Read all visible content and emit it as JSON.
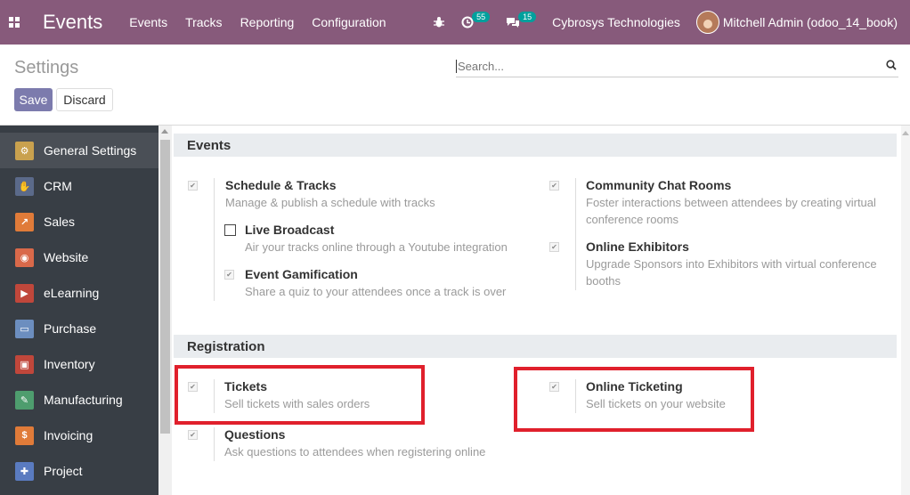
{
  "navbar": {
    "brand": "Events",
    "menu": [
      "Events",
      "Tracks",
      "Reporting",
      "Configuration"
    ],
    "activity_count": "55",
    "message_count": "15",
    "company": "Cybrosys Technologies",
    "user": "Mitchell Admin (odoo_14_book)"
  },
  "control": {
    "title": "Settings",
    "save_label": "Save",
    "discard_label": "Discard",
    "search_placeholder": "Search..."
  },
  "sidebar": {
    "items": [
      {
        "label": "General Settings",
        "icon": "gear-icon",
        "color": "#c9a14e",
        "glyph": "⚙"
      },
      {
        "label": "CRM",
        "icon": "handshake-icon",
        "color": "#5b6a8a",
        "glyph": "✋"
      },
      {
        "label": "Sales",
        "icon": "chart-icon",
        "color": "#e07b39",
        "glyph": "↗"
      },
      {
        "label": "Website",
        "icon": "globe-icon",
        "color": "#d9694a",
        "glyph": "◉"
      },
      {
        "label": "eLearning",
        "icon": "elearning-icon",
        "color": "#c0473b",
        "glyph": "▶"
      },
      {
        "label": "Purchase",
        "icon": "card-icon",
        "color": "#6c8ebf",
        "glyph": "▭"
      },
      {
        "label": "Inventory",
        "icon": "box-icon",
        "color": "#c0473b",
        "glyph": "▣"
      },
      {
        "label": "Manufacturing",
        "icon": "wrench-icon",
        "color": "#4e9d6e",
        "glyph": "✎"
      },
      {
        "label": "Invoicing",
        "icon": "invoice-icon",
        "color": "#e07b39",
        "glyph": "$"
      },
      {
        "label": "Project",
        "icon": "puzzle-icon",
        "color": "#5a7bc0",
        "glyph": "✚"
      }
    ]
  },
  "events_section": {
    "title": "Events",
    "schedule_title": "Schedule & Tracks",
    "schedule_desc": "Manage & publish a schedule with tracks",
    "live_title": "Live Broadcast",
    "live_desc": "Air your tracks online through a Youtube integration",
    "gamification_title": "Event Gamification",
    "gamification_desc": "Share a quiz to your attendees once a track is over",
    "chat_title": "Community Chat Rooms",
    "chat_desc": "Foster interactions between attendees by creating virtual conference rooms",
    "exhibitors_title": "Online Exhibitors",
    "exhibitors_desc": "Upgrade Sponsors into Exhibitors with virtual conference booths"
  },
  "registration_section": {
    "title": "Registration",
    "tickets_title": "Tickets",
    "tickets_desc": "Sell tickets with sales orders",
    "online_title": "Online Ticketing",
    "online_desc": "Sell tickets on your website",
    "questions_title": "Questions",
    "questions_desc": "Ask questions to attendees when registering online"
  },
  "colors": {
    "navbar": "#875a7b",
    "primary_button": "#7c7bad",
    "sidebar": "#383e45",
    "highlight": "#e0202c"
  }
}
